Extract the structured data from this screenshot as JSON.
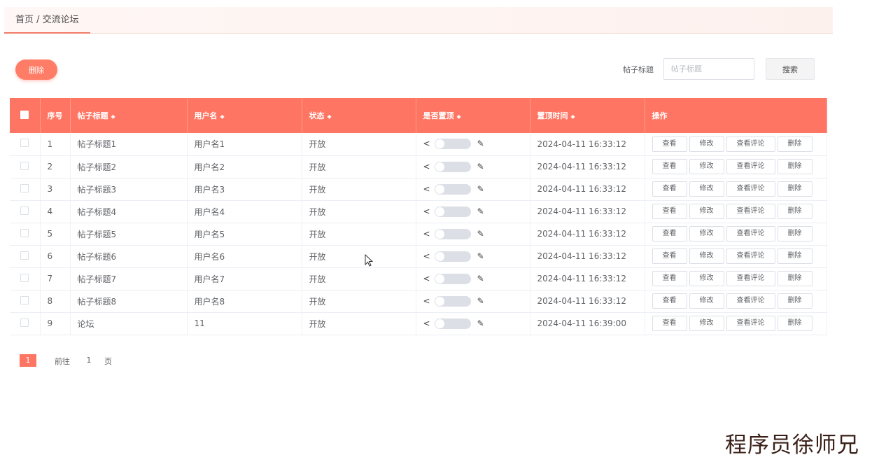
{
  "breadcrumb": "首页 / 交流论坛",
  "toolbar": {
    "delete_label": "删除",
    "search_label": "帖子标题",
    "search_placeholder": "帖子标题",
    "search_button": "搜索"
  },
  "colors": {
    "accent": "#ff7563",
    "text": "#606266"
  },
  "table": {
    "headers": [
      "序号",
      "帖子标题",
      "用户名",
      "状态",
      "是否置顶",
      "置顶时间",
      "操作"
    ],
    "actions": [
      "查看",
      "修改",
      "查看评论",
      "删除"
    ],
    "rows": [
      {
        "idx": "1",
        "title": "帖子标题1",
        "user": "用户名1",
        "status": "开放",
        "time": "2024-04-11 16:33:12"
      },
      {
        "idx": "2",
        "title": "帖子标题2",
        "user": "用户名2",
        "status": "开放",
        "time": "2024-04-11 16:33:12"
      },
      {
        "idx": "3",
        "title": "帖子标题3",
        "user": "用户名3",
        "status": "开放",
        "time": "2024-04-11 16:33:12"
      },
      {
        "idx": "4",
        "title": "帖子标题4",
        "user": "用户名4",
        "status": "开放",
        "time": "2024-04-11 16:33:12"
      },
      {
        "idx": "5",
        "title": "帖子标题5",
        "user": "用户名5",
        "status": "开放",
        "time": "2024-04-11 16:33:12"
      },
      {
        "idx": "6",
        "title": "帖子标题6",
        "user": "用户名6",
        "status": "开放",
        "time": "2024-04-11 16:33:12"
      },
      {
        "idx": "7",
        "title": "帖子标题7",
        "user": "用户名7",
        "status": "开放",
        "time": "2024-04-11 16:33:12"
      },
      {
        "idx": "8",
        "title": "帖子标题8",
        "user": "用户名8",
        "status": "开放",
        "time": "2024-04-11 16:33:12"
      },
      {
        "idx": "9",
        "title": "论坛",
        "user": "11",
        "status": "开放",
        "time": "2024-04-11 16:39:00"
      }
    ]
  },
  "pagination": {
    "current": "1",
    "goto_prefix": "前往",
    "goto_value": "1",
    "goto_suffix": "页"
  },
  "watermark": "程序员徐师兄"
}
